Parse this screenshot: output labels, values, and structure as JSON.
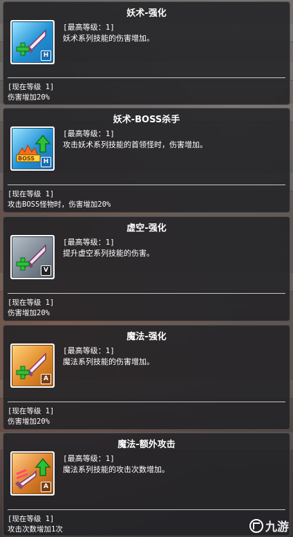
{
  "tooltips": [
    {
      "title": "妖术-强化",
      "max_level": "[最高等级：1]",
      "description": "妖术系列技能的伤害增加。",
      "current_level": "[现在等级 1]",
      "effect": "伤害增加20%",
      "icon": "sword-plus-icon",
      "badge": "H"
    },
    {
      "title": "妖术-BOSS杀手",
      "max_level": "[最高等级：1]",
      "description": "攻击妖术系列技能的首领怪时，伤害增加。",
      "current_level": "[现在等级 1]",
      "effect": "攻击BOSS怪物时，伤害增加20%",
      "icon": "boss-arrow-icon",
      "badge": "H",
      "icon_text": "BOSS"
    },
    {
      "title": "虚空-强化",
      "max_level": "[最高等级：1]",
      "description": "提升虚空系列技能的伤害。",
      "current_level": "[现在等级 1]",
      "effect": "伤害增加20%",
      "icon": "sword-plus-icon",
      "badge": "V"
    },
    {
      "title": "魔法-强化",
      "max_level": "[最高等级：1]",
      "description": "魔法系列技能的伤害增加。",
      "current_level": "[现在等级 1]",
      "effect": "伤害增加20%",
      "icon": "sword-plus-icon",
      "badge": "A"
    },
    {
      "title": "魔法-额外攻击",
      "max_level": "[最高等级：1]",
      "description": "魔法系列技能的攻击次数增加。",
      "current_level": "[现在等级 1]",
      "effect": "攻击次数增加1次",
      "icon": "sword-arrow-icon",
      "badge": "A"
    }
  ],
  "watermark": {
    "text": "九游",
    "icon": "jiuyou-logo-icon"
  },
  "colors": {
    "tooltip_bg": "#222226",
    "icon_blue": "#1f8fd4",
    "icon_gray": "#7b8793",
    "icon_orange": "#e08a2a",
    "plus_green": "#2fbf3a"
  }
}
